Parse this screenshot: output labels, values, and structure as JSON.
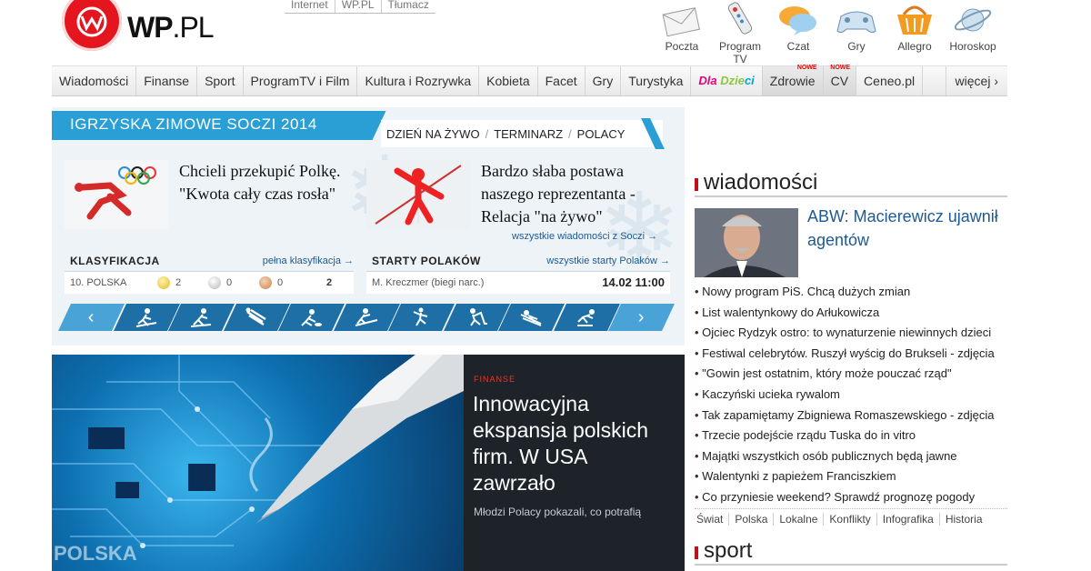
{
  "logo": {
    "brand": "WP",
    "tld": ".PL"
  },
  "toplinks": [
    "Internet",
    "WP.PL",
    "Tłumacz"
  ],
  "services": [
    {
      "label": "Poczta",
      "icon": "mail-icon"
    },
    {
      "label": "Program TV",
      "icon": "remote-icon"
    },
    {
      "label": "Czat",
      "icon": "chat-icon"
    },
    {
      "label": "Gry",
      "icon": "gamepad-icon"
    },
    {
      "label": "Allegro",
      "icon": "basket-icon"
    },
    {
      "label": "Horoskop",
      "icon": "planet-icon"
    }
  ],
  "nav": {
    "items": [
      "Wiadomości",
      "Finanse",
      "Sport",
      "ProgramTV i Film",
      "Kultura i Rozrywka",
      "Kobieta",
      "Facet",
      "Gry",
      "Turystyka"
    ],
    "dla_dzieci": [
      "Dla",
      " ",
      "Dzie",
      "ci"
    ],
    "zdrowie": "Zdrowie",
    "cv": "CV",
    "nowe": "NOWE",
    "ceneo": "Ceneo.pl",
    "more": "więcej ›"
  },
  "soczi": {
    "banner": "IGRZYSKA ZIMOWE SOCZI 2014",
    "tabs": [
      "DZIEŃ NA ŻYWO",
      "TERMINARZ",
      "POLACY"
    ],
    "news": [
      {
        "title": "Chcieli przekupić Polkę. \"Kwota cały czas rosła\""
      },
      {
        "title": "Bardzo słaba postawa naszego reprezentanta - Relacja \"na żywo\""
      }
    ],
    "all_news": "wszystkie wiadomości z Soczi →",
    "classification": {
      "header": "KLASYFIKACJA",
      "link": "pełna klasyfikacja →",
      "country": "10. POLSKA",
      "gold": "2",
      "silver": "0",
      "bronze": "0",
      "total": "2"
    },
    "starts": {
      "header": "STARTY POLAKÓW",
      "link": "wszystkie starty Polaków →",
      "athlete": "M. Kreczmer (biegi narc.)",
      "date": "14.02 11:00"
    },
    "disciplines": [
      "biathlon-icon",
      "bobsleigh-icon",
      "luge-icon",
      "curling-icon",
      "skiing-icon",
      "figure-skating-icon",
      "hockey-icon",
      "ski-jump-icon",
      "speed-skating-icon"
    ],
    "prev": "‹",
    "next": "›"
  },
  "hero": {
    "category": "FINANSE",
    "title": "Innowacyjna ekspansja polskich firm. W USA zawrzało",
    "lead": "Młodzi Polacy pokazali, co potrafią",
    "watermark": "POLSKA"
  },
  "wiadomosci": {
    "header": "wiadomości",
    "main_title": "ABW: Macierewicz ujawnił agentów",
    "list": [
      "Nowy program PiS. Chcą dużych zmian",
      "List walentynkowy do Arłukowicza",
      "Ojciec Rydzyk ostro: to wynaturzenie niewinnych dzieci",
      "Festiwal celebrytów. Ruszył wyścig do Brukseli - zdjęcia",
      "\"Gowin jest ostatnim, który może pouczać rząd\"",
      "Kaczyński ucieka rywalom",
      "Tak zapamiętamy Zbigniewa Romaszewskiego - zdjęcia",
      "Trzecie podejście rządu Tuska do in vitro",
      "Majątki wszystkich osób publicznych będą jawne",
      "Walentynki z papieżem Franciszkiem",
      "Co przyniesie weekend? Sprawdź prognozę pogody"
    ],
    "tags": [
      "Świat",
      "Polska",
      "Lokalne",
      "Konflikty",
      "Infografika",
      "Historia"
    ]
  },
  "sport": {
    "header": "sport"
  }
}
